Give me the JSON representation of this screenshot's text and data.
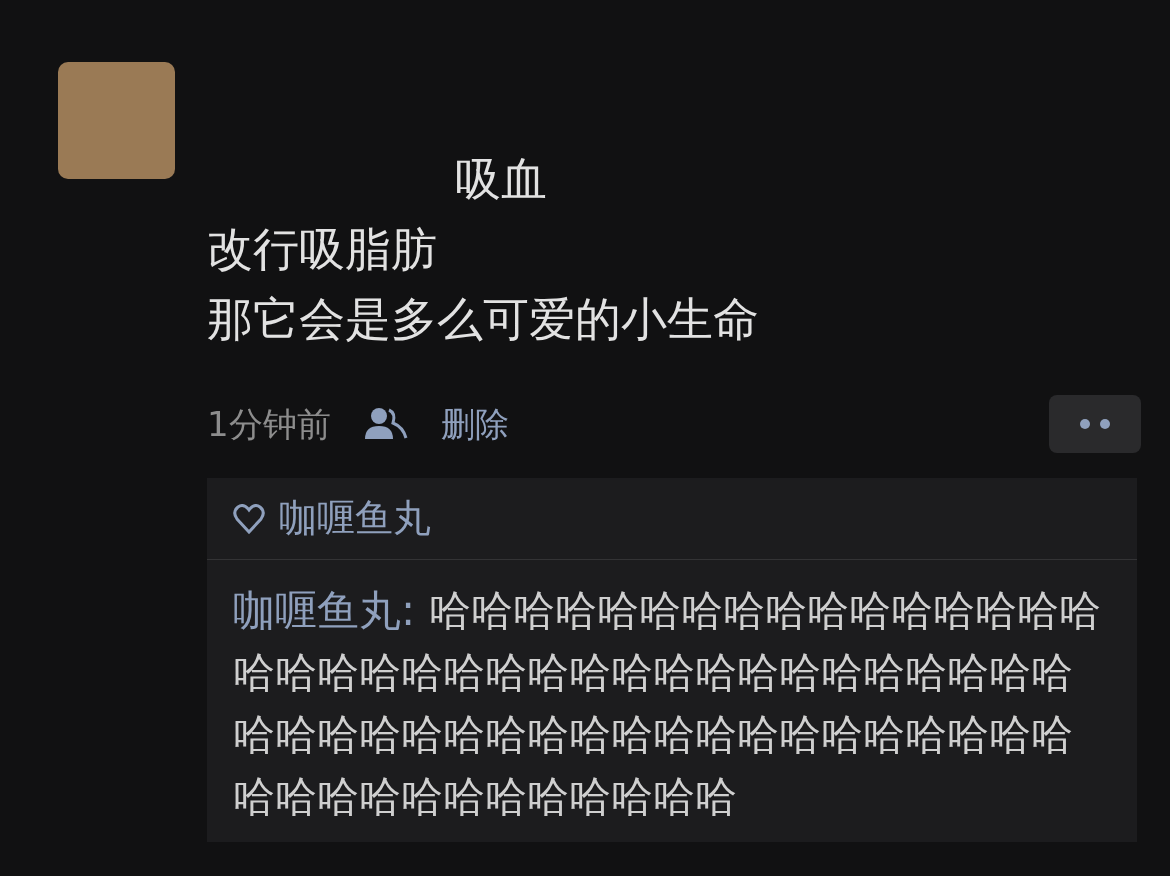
{
  "post": {
    "lines": [
      "吸血",
      "改行吸脂肪",
      "那它会是多么可爱的小生命"
    ],
    "time": "1分钟前",
    "delete_link": "删除"
  },
  "likes": {
    "names": [
      "咖喱鱼丸"
    ]
  },
  "comments": [
    {
      "author": "咖喱鱼丸",
      "separator": ": ",
      "text": "哈哈哈哈哈哈哈哈哈哈哈哈哈哈哈哈哈哈哈哈哈哈哈哈哈哈哈哈哈哈哈哈哈哈哈哈哈哈哈哈哈哈哈哈哈哈哈哈哈哈哈哈哈哈哈哈哈哈哈哈哈哈哈哈哈哈哈哈"
    }
  ]
}
